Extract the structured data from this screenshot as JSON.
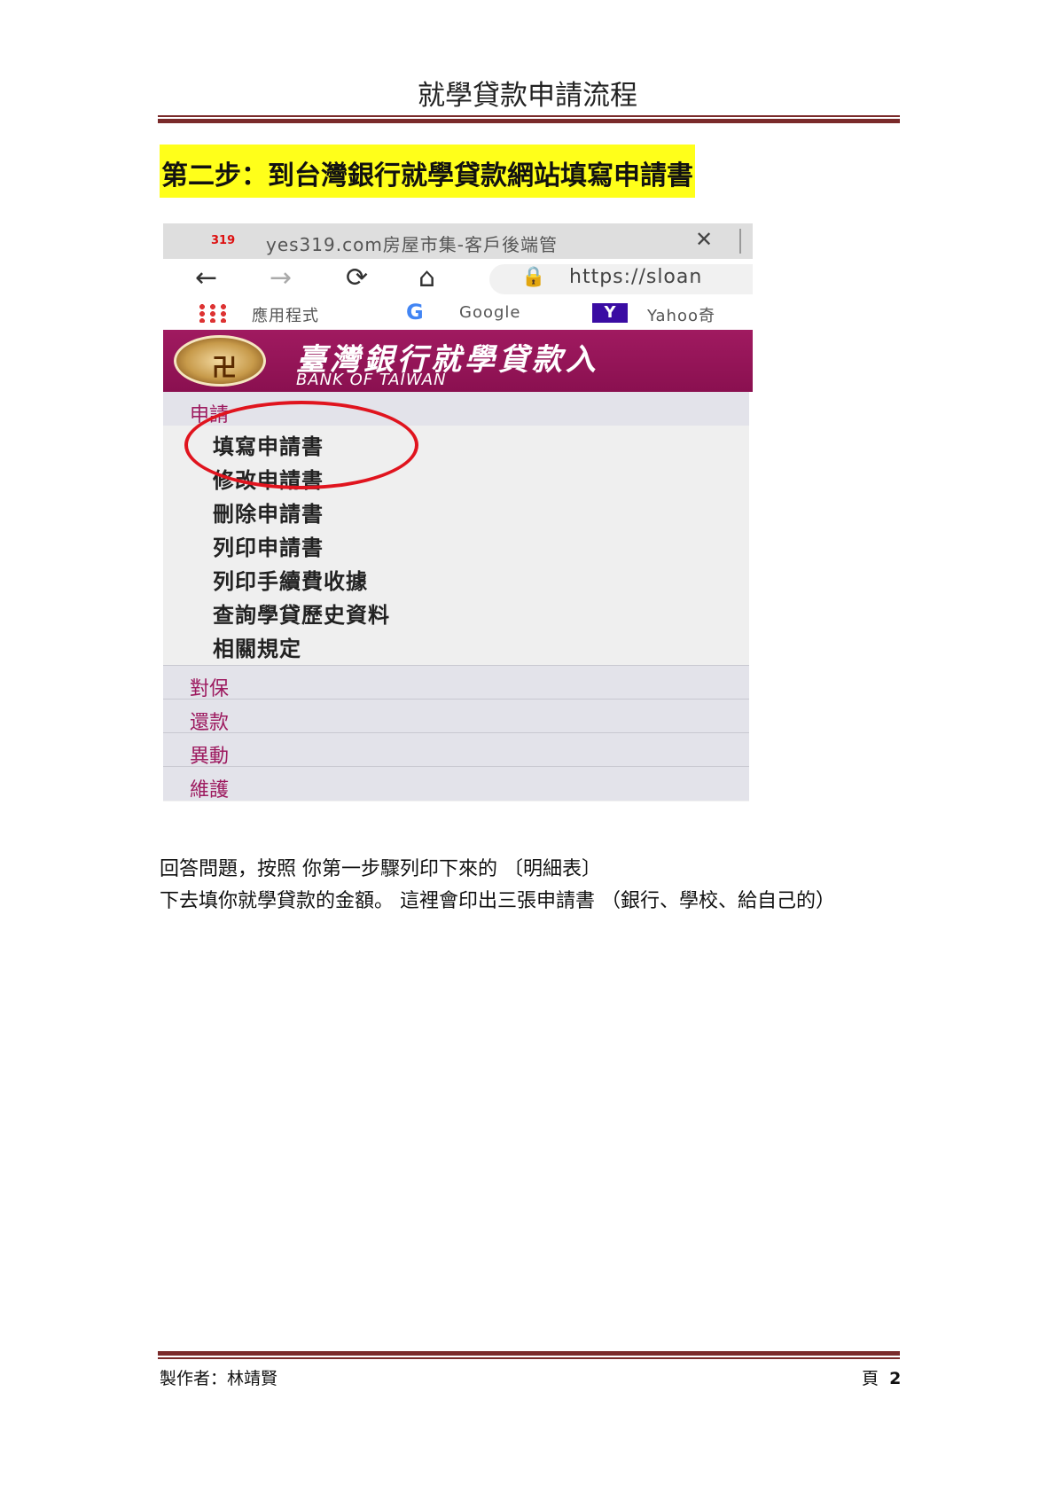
{
  "header": {
    "title": "就學貸款申請流程"
  },
  "step_heading": "第二步：到台灣銀行就學貸款網站填寫申請書",
  "screenshot": {
    "tab": {
      "favicon_text": "319",
      "title": "yes319.com房屋市集-客戶後端管",
      "close_glyph": "✕"
    },
    "toolbar": {
      "back": "←",
      "forward": "→",
      "reload": "⟳",
      "home": "⌂",
      "lock": "🔒",
      "url": "https://sloan"
    },
    "bookmarks": [
      {
        "label": "應用程式"
      },
      {
        "label": "Google",
        "icon_text": "G"
      },
      {
        "label": "Yahoo奇",
        "icon_text": "Y"
      }
    ],
    "banner": {
      "name_zh": "臺灣銀行就學貸款入",
      "name_en": "BANK OF TAIWAN",
      "seal_mark": "卍"
    },
    "menu": {
      "apply": "申請",
      "apply_items": [
        "填寫申請書",
        "修改申請書",
        "刪除申請書",
        "列印申請書",
        "列印手續費收據",
        "查詢學貸歷史資料",
        "相關規定"
      ],
      "sections": [
        "對保",
        "還款",
        "異動",
        "維護"
      ]
    }
  },
  "paragraph": {
    "line1": "回答問題，按照 你第一步驟列印下來的 〔明細表〕",
    "line2": "下去填你就學貸款的金額。 這裡會印出三張申請書 （銀行、學校、給自己的）"
  },
  "footer": {
    "author": "製作者：林靖賢",
    "page_label": "頁",
    "page_number": "2"
  }
}
